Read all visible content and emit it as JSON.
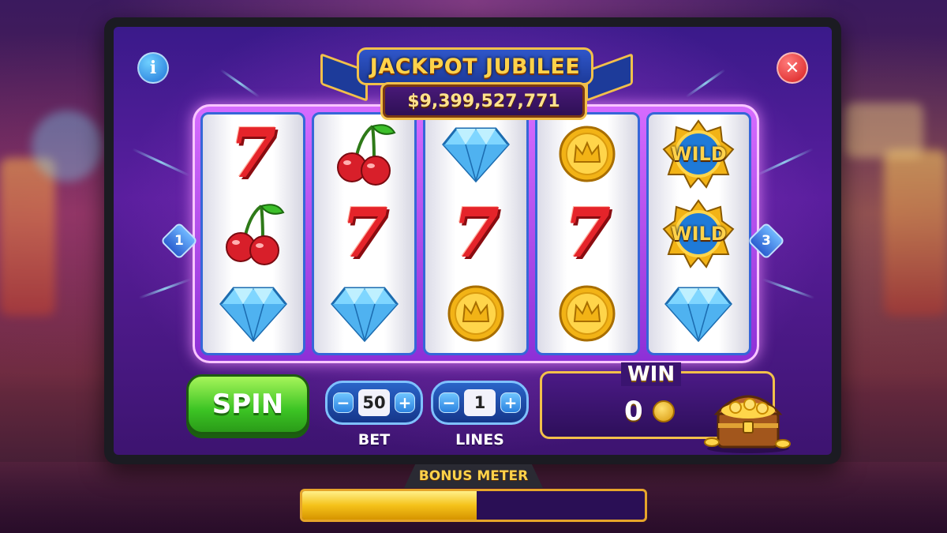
{
  "game": {
    "title": "JACKPOT JUBILEE",
    "jackpot": "$9,399,527,771"
  },
  "reels": [
    [
      "seven",
      "cherry",
      "diamond"
    ],
    [
      "cherry",
      "seven",
      "diamond"
    ],
    [
      "diamond",
      "seven",
      "coin"
    ],
    [
      "coin",
      "seven",
      "coin"
    ],
    [
      "wild",
      "wild",
      "diamond"
    ]
  ],
  "symbols": {
    "seven": "7",
    "wild": "WILD"
  },
  "paylines": {
    "left": "1",
    "right": "3"
  },
  "buttons": {
    "info": "i",
    "close": "✕",
    "spin": "SPIN"
  },
  "bet": {
    "label": "BET",
    "value": "50",
    "minus": "−",
    "plus": "+"
  },
  "lines": {
    "label": "LINES",
    "value": "1",
    "minus": "−",
    "plus": "+"
  },
  "win": {
    "label": "WIN",
    "value": "0"
  },
  "bonus_meter": {
    "label": "BONUS METER",
    "progress": 0.51
  },
  "colors": {
    "accent_gold": "#f2c04a",
    "reel_frame": "#b24cf0",
    "spin_green": "#3cc424",
    "control_blue": "#2a64c8",
    "seven_red": "#e5242a"
  }
}
